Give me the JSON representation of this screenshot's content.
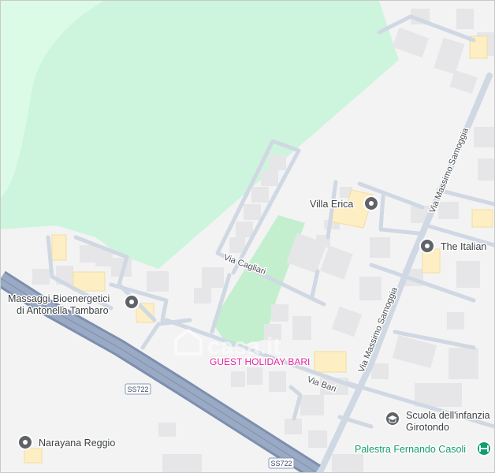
{
  "map": {
    "watermark": "casa.it",
    "colors": {
      "background": "#f3f3f4",
      "park": "#cdf5dd",
      "sports_field": "#c3efcf",
      "building": "#e6e6e8",
      "building_yellow": "#fdefc3",
      "road": "#cfd8e3",
      "highway": "#8fa1bf",
      "poi_gray": "#5f6368",
      "poi_green": "#129e6a",
      "poi_pink": "#e0249f"
    },
    "streets": {
      "via_cagliari": "Via Cagliari",
      "via_massimo_samoggia_upper": "Via Massimo Samoggia",
      "via_massimo_samoggia_lower": "Via Massimo Samoggia",
      "via_bari": "Via Bari"
    },
    "road_shields": {
      "upper": "SS722",
      "lower": "SS722"
    },
    "places": {
      "villa_erica": {
        "label": "Villa Erica",
        "icon": "pin-icon"
      },
      "the_italian": {
        "label": "The Italian",
        "icon": "pin-icon"
      },
      "massaggi": {
        "line1": "Massaggi Bioenergetici",
        "line2": "di Antonella Tambaro",
        "icon": "pin-icon"
      },
      "guest_holiday": {
        "label": "GUEST HOLIDAY BARI"
      },
      "scuola": {
        "line1": "Scuola dell'infanzia",
        "line2": "Girotondo",
        "icon": "school-icon"
      },
      "narayana": {
        "label": "Narayana Reggio",
        "icon": "pin-icon"
      },
      "palestra": {
        "label": "Palestra Fernando Casoli",
        "icon": "dumbbell-icon"
      }
    }
  }
}
